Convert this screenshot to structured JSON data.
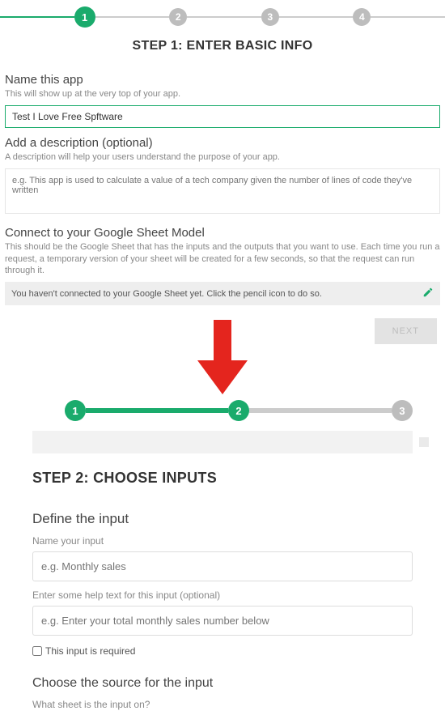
{
  "stepper_top": {
    "steps": [
      "1",
      "2",
      "3",
      "4"
    ],
    "current": 1
  },
  "step1": {
    "title": "STEP 1: ENTER BASIC INFO",
    "name_section": {
      "title": "Name this app",
      "help": "This will show up at the very top of your app.",
      "value": "Test I Love Free Spftware"
    },
    "desc_section": {
      "title": "Add a description (optional)",
      "help": "A description will help your users understand the purpose of your app.",
      "placeholder": "e.g. This app is used to calculate a value of a tech company given the number of lines of code they've written"
    },
    "connect_section": {
      "title": "Connect to your Google Sheet Model",
      "help": "This should be the Google Sheet that has the inputs and the outputs that you want to use. Each time you run a request, a temporary version of your sheet will be created for a few seconds, so that the request can run through it.",
      "status": "You haven't connected to your Google Sheet yet. Click the pencil icon to do so."
    },
    "next_label": "NEXT"
  },
  "stepper_inner": {
    "steps": [
      "1",
      "2",
      "3"
    ],
    "current": 2
  },
  "step2": {
    "title": "STEP 2: CHOOSE INPUTS",
    "define_title": "Define the input",
    "name_input": {
      "label": "Name your input",
      "placeholder": "e.g. Monthly sales"
    },
    "help_input": {
      "label": "Enter some help text for this input (optional)",
      "placeholder": "e.g. Enter your total monthly sales number below"
    },
    "required_label": "This input is required",
    "source_title": "Choose the source for the input",
    "sheet_label": "What sheet is the input on?"
  }
}
